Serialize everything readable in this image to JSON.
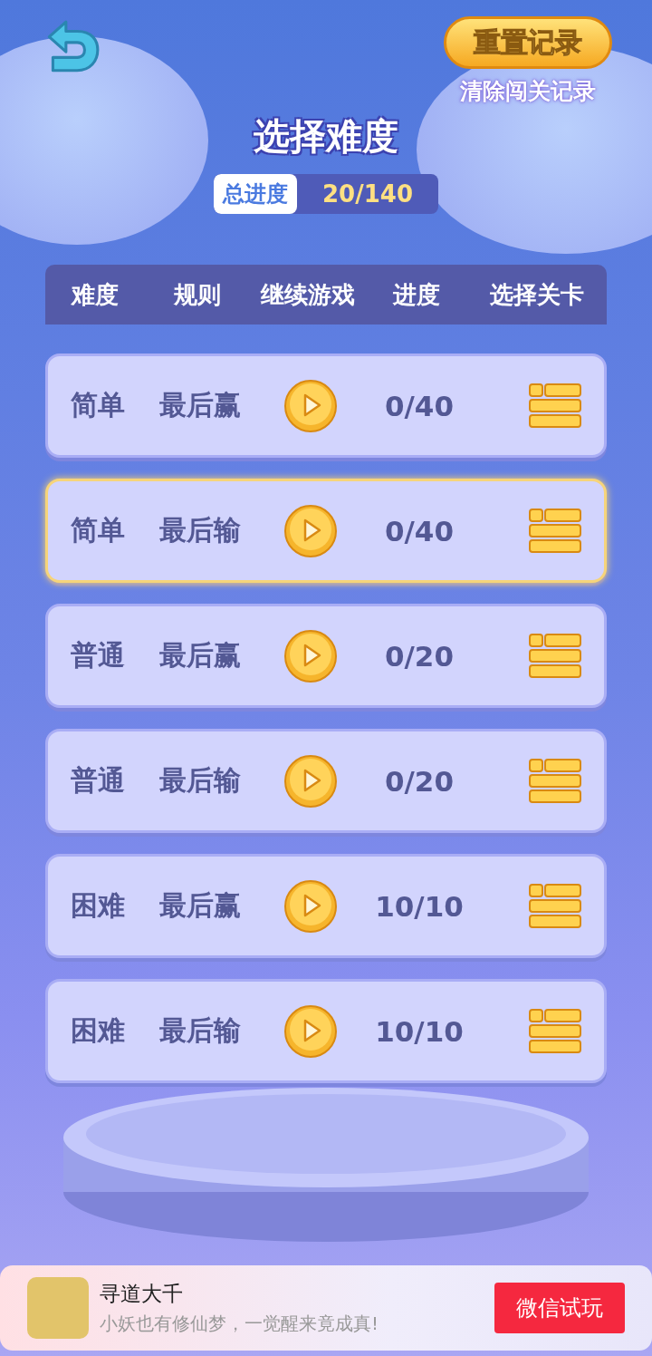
{
  "top_bar": {
    "reset_button": "重置记录",
    "reset_hint": "清除闯关记录"
  },
  "title": "选择难度",
  "total_progress": {
    "label": "总进度",
    "value": "20/140"
  },
  "table": {
    "columns": [
      "难度",
      "规则",
      "继续游戏",
      "进度",
      "选择关卡"
    ],
    "rows": [
      {
        "difficulty": "简单",
        "rule": "最后赢",
        "progress": "0/40",
        "selected": false
      },
      {
        "difficulty": "简单",
        "rule": "最后输",
        "progress": "0/40",
        "selected": true
      },
      {
        "difficulty": "普通",
        "rule": "最后赢",
        "progress": "0/20",
        "selected": false
      },
      {
        "difficulty": "普通",
        "rule": "最后输",
        "progress": "0/20",
        "selected": false
      },
      {
        "difficulty": "困难",
        "rule": "最后赢",
        "progress": "10/10",
        "selected": false
      },
      {
        "difficulty": "困难",
        "rule": "最后输",
        "progress": "10/10",
        "selected": false
      }
    ]
  },
  "ad_banner": {
    "title": "寻道大千",
    "description": "小妖也有修仙梦，一觉醒来竟成真!",
    "button": "微信试玩"
  }
}
